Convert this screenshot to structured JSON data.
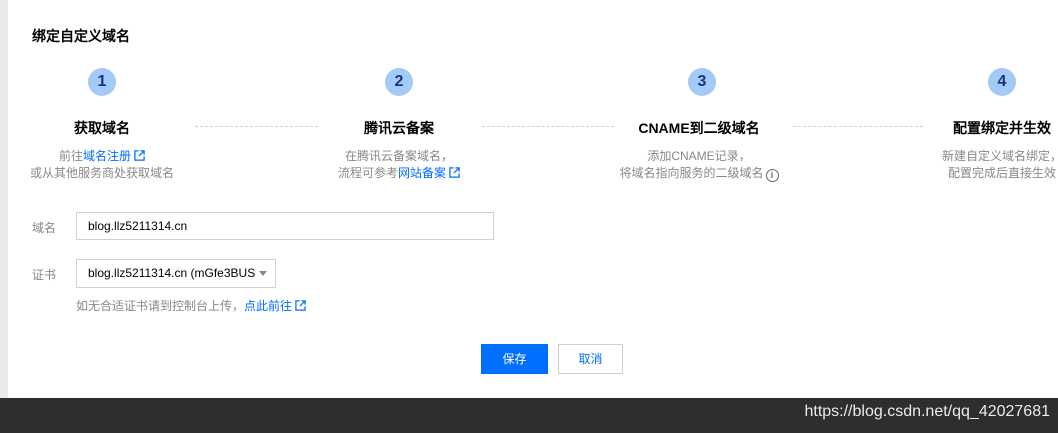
{
  "dialog": {
    "title": "绑定自定义域名"
  },
  "steps": [
    {
      "number": "1",
      "title": "获取域名",
      "desc_prefix": "前往",
      "link": "域名注册",
      "desc_line2": "或从其他服务商处获取域名"
    },
    {
      "number": "2",
      "title": "腾讯云备案",
      "desc_line1": "在腾讯云备案域名，",
      "desc_prefix": "流程可参考",
      "link": "网站备案"
    },
    {
      "number": "3",
      "title": "CNAME到二级域名",
      "desc_line1": "添加CNAME记录，",
      "desc_line2": "将域名指向服务的二级域名"
    },
    {
      "number": "4",
      "title": "配置绑定并生效",
      "desc_line1": "新建自定义域名绑定，",
      "desc_line2": "配置完成后直接生效"
    }
  ],
  "form": {
    "domain_label": "域名",
    "domain_value": "blog.llz5211314.cn",
    "cert_label": "证书",
    "cert_value": "blog.llz5211314.cn (mGfe3BUS",
    "hint_text": "如无合适证书请到控制台上传，",
    "hint_link": "点此前往"
  },
  "buttons": {
    "save": "保存",
    "cancel": "取消"
  },
  "watermark": "https://blog.csdn.net/qq_42027681",
  "icons": {
    "external": "external-link-icon",
    "info": "info-icon",
    "caret": "chevron-down-icon"
  },
  "colors": {
    "accent": "#006eff",
    "step_circle": "#a6caf7",
    "step_number": "#14357a",
    "muted_text": "#888888",
    "bottom_bar": "#2d2e30"
  }
}
